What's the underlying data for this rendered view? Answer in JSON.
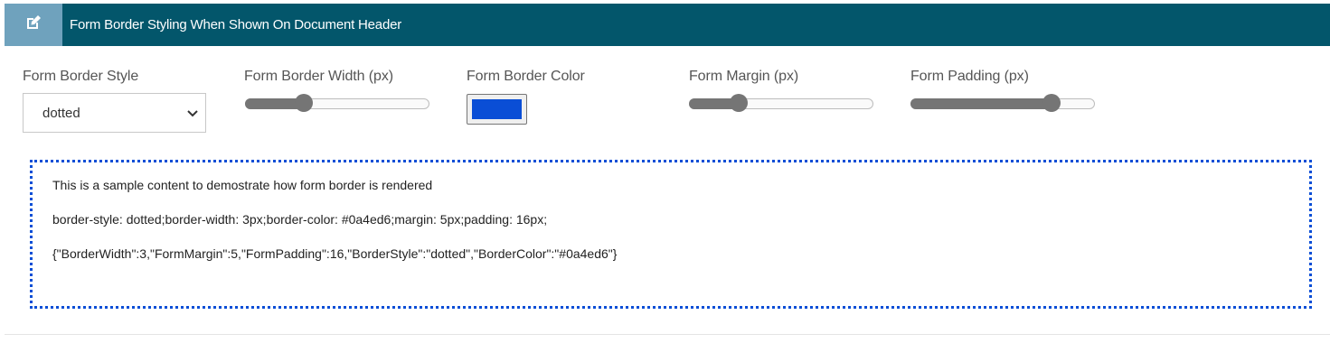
{
  "header": {
    "title": "Form Border Styling When Shown On Document Header",
    "icon": "edit-icon"
  },
  "fields": {
    "border_style": {
      "label": "Form Border Style",
      "value": "dotted"
    },
    "border_width": {
      "label": "Form Border Width (px)",
      "value": 3,
      "fraction": 0.32
    },
    "border_color": {
      "label": "Form Border Color",
      "value": "#0a4ed6"
    },
    "margin": {
      "label": "Form Margin (px)",
      "value": 5,
      "fraction": 0.27
    },
    "padding": {
      "label": "Form Padding (px)",
      "value": 16,
      "fraction": 0.77
    }
  },
  "preview": {
    "line1": "This is a sample content to demostrate how form border is rendered",
    "line2": "border-style: dotted;border-width: 3px;border-color: #0a4ed6;margin: 5px;padding: 16px;",
    "line3": "{\"BorderWidth\":3,\"FormMargin\":5,\"FormPadding\":16,\"BorderStyle\":\"dotted\",\"BorderColor\":\"#0a4ed6\"}"
  },
  "colors": {
    "header_bg": "#03566b",
    "icon_box_bg": "#6fa2bd",
    "slider": "#757575"
  }
}
